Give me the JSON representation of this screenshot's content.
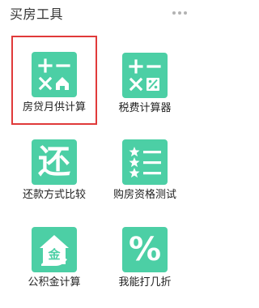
{
  "header": {
    "title": "买房工具",
    "more_icon": "more-dots-icon"
  },
  "colors": {
    "accent": "#4ccfa5",
    "selection_border": "#e03a3a"
  },
  "tools": [
    {
      "label": "房贷月供计算",
      "icon": "calculator-house-icon",
      "selected": true
    },
    {
      "label": "税费计算器",
      "icon": "calculator-percent-icon",
      "selected": false
    },
    {
      "label": "还款方式比较",
      "icon": "huan-character-icon",
      "glyph": "还",
      "selected": false
    },
    {
      "label": "购房资格测试",
      "icon": "star-checklist-icon",
      "selected": false
    },
    {
      "label": "公积金计算",
      "icon": "house-fund-icon",
      "glyph": "金",
      "selected": false
    },
    {
      "label": "我能打几折",
      "icon": "percent-icon",
      "glyph": "%",
      "selected": false
    }
  ]
}
